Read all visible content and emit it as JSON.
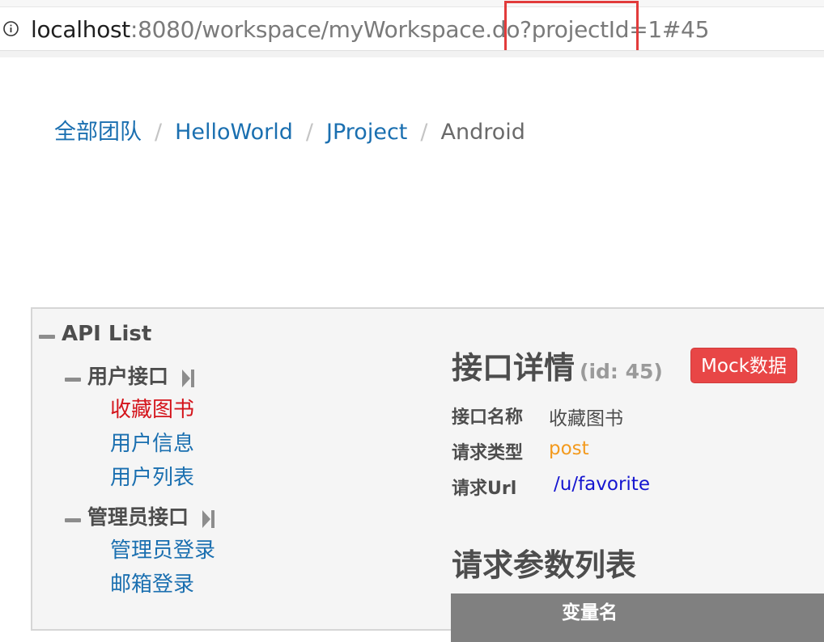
{
  "browser": {
    "url_host": "localhost",
    "url_rest": ":8080/workspace/myWorkspace.do?projectId=1#45"
  },
  "breadcrumb": {
    "items": [
      "全部团队",
      "HelloWorld",
      "JProject"
    ],
    "current": "Android",
    "separator": "/"
  },
  "tree": {
    "root_label": "API List",
    "groups": [
      {
        "label": "用户接口",
        "items": [
          "收藏图书",
          "用户信息",
          "用户列表"
        ],
        "active_index": 0
      },
      {
        "label": "管理员接口",
        "items": [
          "管理员登录",
          "邮箱登录"
        ]
      }
    ]
  },
  "detail": {
    "title": "接口详情",
    "id_text": "(id: 45)",
    "mock_button": "Mock数据",
    "fields": [
      {
        "label": "接口名称",
        "value": "收藏图书"
      },
      {
        "label": "请求类型",
        "value": "post"
      },
      {
        "label": "请求Url",
        "value": "/u/favorite"
      }
    ],
    "params_title": "请求参数列表",
    "params_table": {
      "columns": [
        "变量名"
      ]
    }
  },
  "colors": {
    "link": "#1a6fb0",
    "active_item": "#d4141b",
    "mock_button": "#e84646",
    "request_type": "#f39a1d",
    "request_url": "#1515d0",
    "highlight_box": "#e23b3b"
  }
}
